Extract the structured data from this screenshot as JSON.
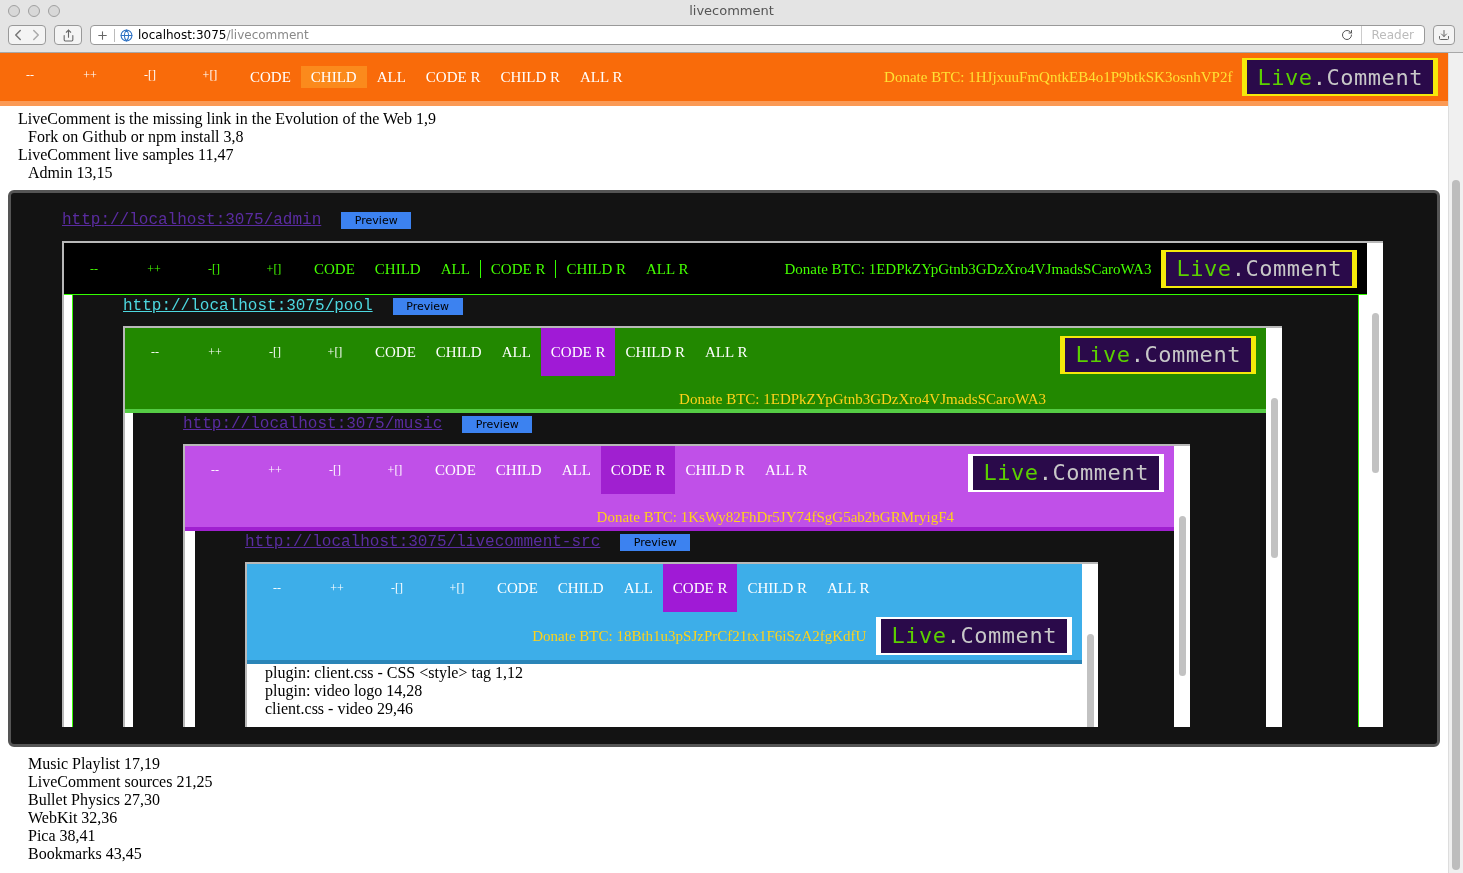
{
  "window": {
    "title": "livecomment",
    "address_host": "localhost:3075",
    "address_path": "/livecomment",
    "reader": "Reader"
  },
  "toolbar": {
    "buttons": [
      {
        "label": "--",
        "selected": false
      },
      {
        "label": "++",
        "selected": false
      },
      {
        "label": "-[]",
        "selected": false
      },
      {
        "label": "+[]",
        "selected": false
      },
      {
        "label": "CODE",
        "selected": false
      },
      {
        "label": "CHILD",
        "selected": true
      },
      {
        "label": "ALL",
        "selected": false
      },
      {
        "label": "CODE R",
        "selected": false
      },
      {
        "label": "CHILD R",
        "selected": false
      },
      {
        "label": "ALL R",
        "selected": false
      }
    ],
    "donate": "Donate BTC: 1HJjxuuFmQntkEB4o1P9btkSK3osnhVP2f",
    "logo": {
      "live": "Live",
      "rest": ".Comment"
    }
  },
  "outline": [
    {
      "text": "LiveComment is the missing link in the Evolution of the Web 1,9",
      "children": [
        {
          "kind": "entry",
          "text": "Fork on Github or npm install 3,8"
        }
      ]
    },
    {
      "text": "LiveComment live samples 11,47",
      "children": [
        {
          "kind": "entry",
          "text": "Admin 13,15"
        },
        {
          "kind": "embed",
          "frame": {
            "url": "http://localhost:3075/admin",
            "visited": true,
            "preview": "Preview",
            "page": {
              "buttons": [
                {
                  "label": "--",
                  "selected": false
                },
                {
                  "label": "++",
                  "selected": false
                },
                {
                  "label": "-[]",
                  "selected": false
                },
                {
                  "label": "+[]",
                  "selected": false
                },
                {
                  "label": "CODE",
                  "selected": false
                },
                {
                  "label": "CHILD",
                  "selected": false
                },
                {
                  "label": "ALL",
                  "selected": false
                },
                {
                  "label": "CODE R",
                  "selected": true
                },
                {
                  "label": "CHILD R",
                  "selected": false
                },
                {
                  "label": "ALL R",
                  "selected": false
                }
              ],
              "donate": "Donate BTC: 1EDPkZYpGtnb3GDzXro4VJmadsSCaroWA3",
              "logo": {
                "live": "Live",
                "rest": ".Comment"
              },
              "frame": {
                "url": "http://localhost:3075/pool",
                "visited": false,
                "preview": "Preview",
                "page": {
                  "buttons": [
                    {
                      "label": "--",
                      "selected": false
                    },
                    {
                      "label": "++",
                      "selected": false
                    },
                    {
                      "label": "-[]",
                      "selected": false
                    },
                    {
                      "label": "+[]",
                      "selected": false
                    },
                    {
                      "label": "CODE",
                      "selected": false
                    },
                    {
                      "label": "CHILD",
                      "selected": false
                    },
                    {
                      "label": "ALL",
                      "selected": false
                    },
                    {
                      "label": "CODE R",
                      "selected": true
                    },
                    {
                      "label": "CHILD R",
                      "selected": false
                    },
                    {
                      "label": "ALL R",
                      "selected": false
                    }
                  ],
                  "donate": "Donate BTC: 1EDPkZYpGtnb3GDzXro4VJmadsSCaroWA3",
                  "logo": {
                    "live": "Live",
                    "rest": ".Comment"
                  },
                  "frame": {
                    "url": "http://localhost:3075/music",
                    "visited": true,
                    "preview": "Preview",
                    "page": {
                      "buttons": [
                        {
                          "label": "--",
                          "selected": false
                        },
                        {
                          "label": "++",
                          "selected": false
                        },
                        {
                          "label": "-[]",
                          "selected": false
                        },
                        {
                          "label": "+[]",
                          "selected": false
                        },
                        {
                          "label": "CODE",
                          "selected": false
                        },
                        {
                          "label": "CHILD",
                          "selected": false
                        },
                        {
                          "label": "ALL",
                          "selected": false
                        },
                        {
                          "label": "CODE R",
                          "selected": true
                        },
                        {
                          "label": "CHILD R",
                          "selected": false
                        },
                        {
                          "label": "ALL R",
                          "selected": false
                        }
                      ],
                      "donate": "Donate BTC: 1KsWy82FhDr5JY74fSgG5ab2bGRMryigF4",
                      "logo": {
                        "live": "Live",
                        "rest": ".Comment"
                      },
                      "frame": {
                        "url": "http://localhost:3075/livecomment-src",
                        "visited": true,
                        "preview": "Preview",
                        "page": {
                          "buttons": [
                            {
                              "label": "--",
                              "selected": false
                            },
                            {
                              "label": "++",
                              "selected": false
                            },
                            {
                              "label": "-[]",
                              "selected": false
                            },
                            {
                              "label": "+[]",
                              "selected": false
                            },
                            {
                              "label": "CODE",
                              "selected": false
                            },
                            {
                              "label": "CHILD",
                              "selected": false
                            },
                            {
                              "label": "ALL",
                              "selected": false
                            },
                            {
                              "label": "CODE R",
                              "selected": true
                            },
                            {
                              "label": "CHILD R",
                              "selected": false
                            },
                            {
                              "label": "ALL R",
                              "selected": false
                            }
                          ],
                          "donate": "Donate BTC: 18Bth1u3pSJzPrCf21tx1F6iSzA2fgKdfU",
                          "logo": {
                            "live": "Live",
                            "rest": ".Comment"
                          },
                          "lines": [
                            "plugin: client.css - CSS <style> tag 1,12",
                            "plugin: video logo 14,28",
                            "client.css - video 29,46"
                          ]
                        }
                      }
                    }
                  }
                }
              }
            }
          }
        },
        {
          "kind": "entry",
          "text": "Music Playlist 17,19"
        },
        {
          "kind": "entry",
          "text": "LiveComment sources 21,25"
        },
        {
          "kind": "entry",
          "text": "Bullet Physics 27,30"
        },
        {
          "kind": "entry",
          "text": "WebKit 32,36"
        },
        {
          "kind": "entry",
          "text": "Pica 38,41"
        },
        {
          "kind": "entry",
          "text": "Bookmarks 43,45"
        }
      ]
    }
  ]
}
